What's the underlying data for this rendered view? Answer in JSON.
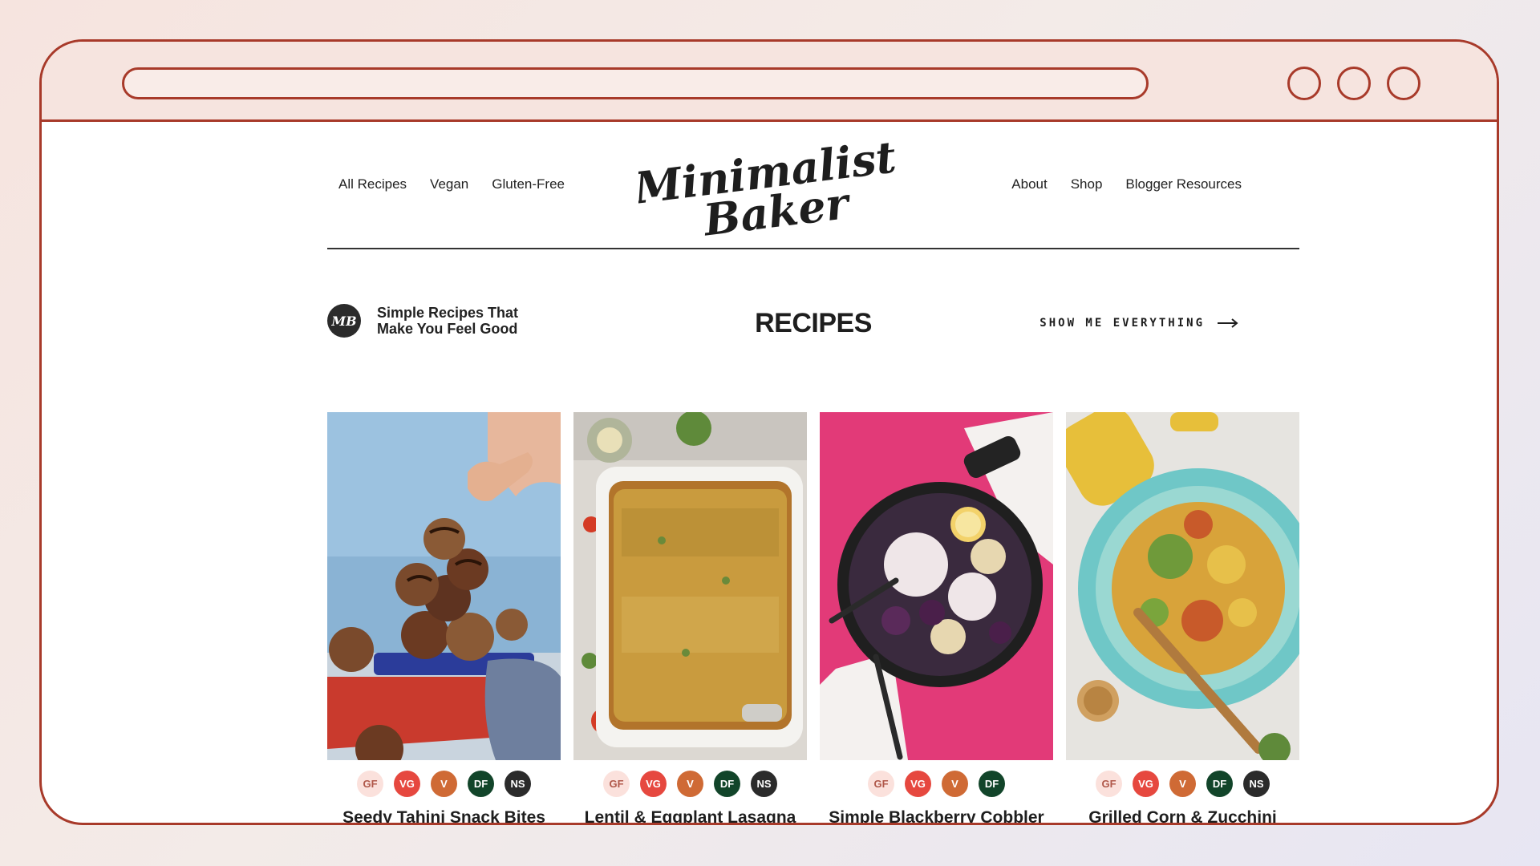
{
  "header": {
    "nav_left": [
      "All Recipes",
      "Vegan",
      "Gluten-Free"
    ],
    "nav_right": [
      "About",
      "Shop",
      "Blogger Resources"
    ],
    "logo_text": "Minimalist Baker"
  },
  "intro": {
    "badge": "MB",
    "tagline": "Simple Recipes That Make You Feel Good",
    "title": "RECIPES",
    "show_all": "SHOW ME EVERYTHING"
  },
  "colors": {
    "frame": "#a83a2a",
    "badge_GF": "#fbe1dc",
    "badge_VG": "#e6483f",
    "badge_V": "#cf6a35",
    "badge_DF": "#12452a",
    "badge_NS": "#2b2b2b"
  },
  "recipes": [
    {
      "title": "Seedy Tahini Snack Bites (Nut-Free!)",
      "badges": [
        "GF",
        "VG",
        "V",
        "DF",
        "NS"
      ]
    },
    {
      "title": "Lentil & Eggplant Lasagna",
      "badges": [
        "GF",
        "VG",
        "V",
        "DF",
        "NS"
      ]
    },
    {
      "title": "Simple Blackberry Cobbler (Vegan + GF)",
      "badges": [
        "GF",
        "VG",
        "V",
        "DF"
      ]
    },
    {
      "title": "Grilled Corn & Zucchini Salad with Sun-Dried Tomato Vinaigrette",
      "badges": [
        "GF",
        "VG",
        "V",
        "DF",
        "NS"
      ]
    }
  ]
}
